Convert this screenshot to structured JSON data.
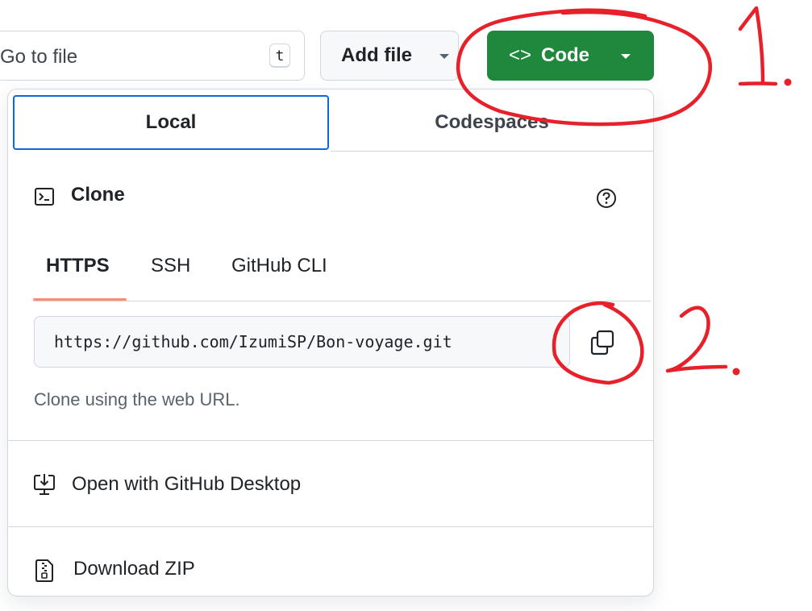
{
  "toolbar": {
    "goto_placeholder": "Go to file",
    "goto_visible_text": "Go to file",
    "shortcut_key": "t",
    "add_file_label": "Add file",
    "code_icon_glyph": "<>",
    "code_label": "Code",
    "code_button_color": "#1f883d"
  },
  "panel": {
    "tabs": [
      {
        "label": "Local",
        "selected": true
      },
      {
        "label": "Codespaces",
        "selected": false
      }
    ],
    "clone": {
      "title": "Clone",
      "protocols": [
        {
          "label": "HTTPS",
          "selected": true
        },
        {
          "label": "SSH",
          "selected": false
        },
        {
          "label": "GitHub CLI",
          "selected": false
        }
      ],
      "url": "https://github.com/IzumiSP/Bon-voyage.git",
      "hint": "Clone using the web URL."
    },
    "actions": [
      {
        "label": "Open with GitHub Desktop",
        "icon": "desktop-download-icon"
      },
      {
        "label": "Download ZIP",
        "icon": "file-zip-icon"
      }
    ]
  },
  "annotations": {
    "color": "#e8202a",
    "step1": "1.",
    "step2": "2."
  }
}
